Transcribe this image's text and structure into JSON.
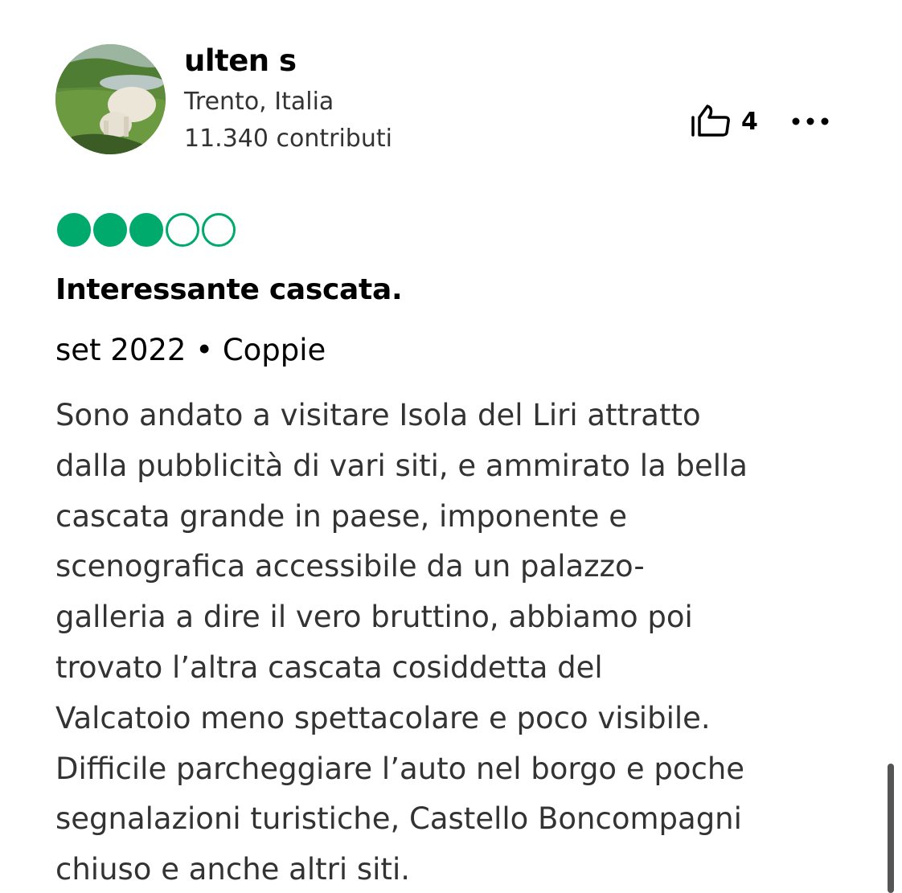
{
  "reviewer": {
    "name": "ulten s",
    "location": "Trento, Italia",
    "contributions": "11.340 contributi"
  },
  "actions": {
    "helpful_count": "4",
    "helpful_icon": "thumbs-up-icon",
    "more_icon": "more-dots-icon"
  },
  "rating": {
    "value": 3,
    "max": 5,
    "color": "#00aa6c"
  },
  "review": {
    "title": "Interessante cascata.",
    "meta": "set 2022 • Coppie",
    "body_lines": [
      "Sono andato a visitare Isola del Liri attratto",
      "dalla pubblicità di vari siti, e ammirato la bella",
      "cascata grande in paese, imponente e",
      "scenografica accessibile da un palazzo-",
      "galleria a dire il vero bruttino, abbiamo poi",
      "trovato l’altra cascata cosiddetta del",
      "Valcatoio meno spettacolare e poco visibile.",
      "Difficile parcheggiare l’auto nel borgo e poche",
      "segnalazioni turistiche, Castello Boncompagni",
      "chiuso e anche altri siti."
    ]
  }
}
